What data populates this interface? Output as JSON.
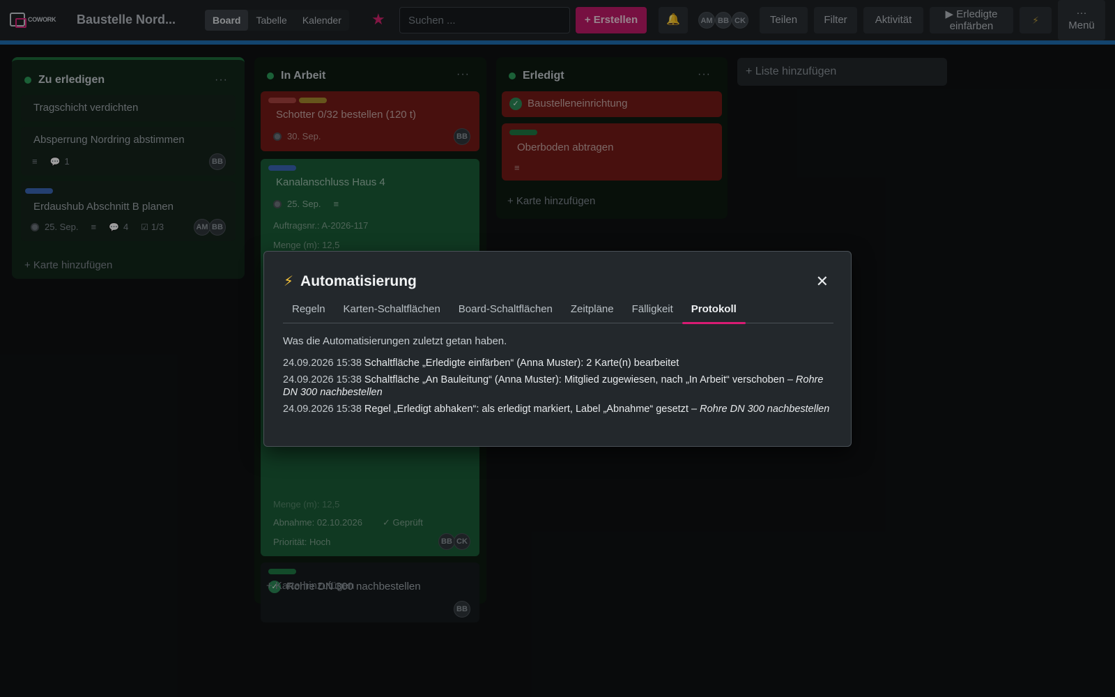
{
  "app": {
    "logo_text": "COWORK",
    "board_title": "Baustelle Nord..."
  },
  "views": {
    "board": "Board",
    "table": "Tabelle",
    "calendar": "Kalender"
  },
  "search": {
    "placeholder": "Suchen ..."
  },
  "toolbar": {
    "create": "+ Erstellen",
    "members": [
      "AM",
      "BB",
      "CK"
    ],
    "share": "Teilen",
    "filter": "Filter",
    "activity": "Aktivität",
    "mark_done_line1": "▶ Erledigte",
    "mark_done_line2": "einfärben",
    "menu_dots": "···",
    "menu": "Menü"
  },
  "colors": {
    "accent": "#c11a6a",
    "stripe": "#1f6fb2",
    "done_green": "#2c9c59",
    "card_red": "#751a17",
    "card_green": "#1a5d37"
  },
  "lists": {
    "todo": {
      "title": "Zu erledigen",
      "more": "···",
      "cards": [
        {
          "title": "Tragschicht verdichten"
        },
        {
          "title": "Absperrung Nordring abstimmen",
          "comments": "1",
          "member": "BB"
        },
        {
          "title": "Erdaushub Abschnitt B planen",
          "due": "25. Sep.",
          "comments": "4",
          "checklist": "1/3",
          "members": [
            "AM",
            "BB"
          ]
        }
      ],
      "add_card": "+ Karte hinzufügen"
    },
    "work": {
      "title": "In Arbeit",
      "more": "···",
      "cards": [
        {
          "title": "Schotter 0/32 bestellen (120 t)",
          "due": "30. Sep.",
          "member": "BB"
        },
        {
          "title": "Kanalanschluss Haus 4",
          "due": "25. Sep.",
          "order": "Auftragsnr.: A-2026-117",
          "amount": "Menge (m): 12,5"
        },
        {
          "amount": "Menge (m): 12,5",
          "acceptance": "Abnahme: 02.10.2026",
          "checked": "✓ Geprüft",
          "priority": "Priorität: Hoch",
          "members": [
            "BB",
            "CK"
          ]
        },
        {
          "title": "Rohre DN 300 nachbestellen",
          "member": "BB"
        }
      ],
      "add_card": "+ Karte hinzufügen"
    },
    "done": {
      "title": "Erledigt",
      "more": "···",
      "cards": [
        {
          "title": "Baustelleneinrichtung"
        },
        {
          "title": "Oberboden abtragen"
        }
      ],
      "add_card": "+ Karte hinzufügen"
    },
    "add_list": "+ Liste hinzufügen"
  },
  "modal": {
    "title": "Automatisierung",
    "close": "✕",
    "tabs": [
      "Regeln",
      "Karten-Schaltflächen",
      "Board-Schaltflächen",
      "Zeitpläne",
      "Fälligkeit",
      "Protokoll"
    ],
    "active_tab": "Protokoll",
    "subtitle": "Was die Automatisierungen zuletzt getan haben.",
    "log": [
      {
        "time": "24.09.2026 15:38",
        "text": "Schaltfläche „Erledigte einfärben“ (Anna Muster): 2 Karte(n) bearbeitet",
        "card": ""
      },
      {
        "time": "24.09.2026 15:38",
        "text": "Schaltfläche „An Bauleitung“ (Anna Muster): Mitglied zugewiesen, nach „In Arbeit“ verschoben –",
        "card": "Rohre DN 300 nachbestellen"
      },
      {
        "time": "24.09.2026 15:38",
        "text": "Regel „Erledigt abhaken“: als erledigt markiert, Label „Abnahme“ gesetzt –",
        "card": "Rohre DN 300 nachbestellen"
      }
    ]
  }
}
